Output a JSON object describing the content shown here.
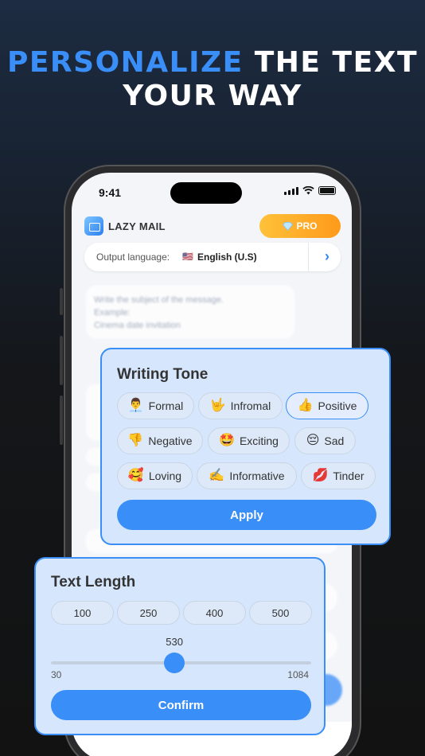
{
  "headline": {
    "accent": "PERSONALIZE",
    "rest_line1": "THE TEXT",
    "line2": "YOUR WAY"
  },
  "status_bar": {
    "time": "9:41"
  },
  "app": {
    "name": "LAZY MAIL",
    "pro_label": "PRO",
    "pro_icon": "diamond-icon"
  },
  "language": {
    "label": "Output language:",
    "flag": "🇺🇸",
    "value": "English (U.S)"
  },
  "background_content": {
    "prompt_line1": "Write the subject of the message.",
    "prompt_line2": "Example:",
    "prompt_line3": "Cinema date invitation"
  },
  "writing_tone": {
    "title": "Writing Tone",
    "options": [
      {
        "emoji": "👨‍💼",
        "label": "Formal"
      },
      {
        "emoji": "🤟",
        "label": "Infromal"
      },
      {
        "emoji": "👍",
        "label": "Positive",
        "selected": true
      },
      {
        "emoji": "👎",
        "label": "Negative"
      },
      {
        "emoji": "🤩",
        "label": "Exciting"
      },
      {
        "emoji": "😔",
        "label": "Sad"
      },
      {
        "emoji": "🥰",
        "label": "Loving"
      },
      {
        "emoji": "✍️",
        "label": "Informative"
      },
      {
        "emoji": "💋",
        "label": "Tinder"
      }
    ],
    "apply_label": "Apply"
  },
  "text_length": {
    "title": "Text Length",
    "presets": [
      "100",
      "250",
      "400",
      "500"
    ],
    "slider": {
      "min": 30,
      "max": 1084,
      "value": 530,
      "min_label": "30",
      "max_label": "1084",
      "value_label": "530"
    },
    "confirm_label": "Confirm"
  },
  "colors": {
    "accent": "#3a8ef8",
    "panel_bg": "#d6e7fd",
    "pro_gradient_start": "#ffc13a",
    "pro_gradient_end": "#ff9a1a"
  }
}
